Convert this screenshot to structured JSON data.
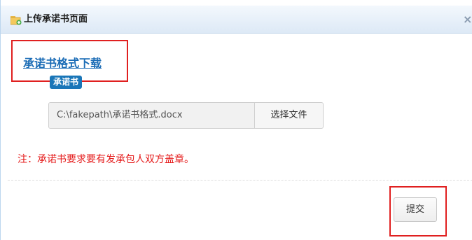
{
  "dialog": {
    "title": "上传承诺书页面",
    "close_label": "×"
  },
  "content": {
    "download_link": "承诺书格式下载",
    "badge": "承诺书",
    "file_input": {
      "value": "C:\\fakepath\\承诺书格式.docx",
      "button_label": "选择文件"
    },
    "note": "注：承诺书要求要有发承包人双方盖章。"
  },
  "footer": {
    "submit_label": "提交"
  },
  "colors": {
    "highlight": "#e02020",
    "link": "#1b6cb6",
    "badge_bg": "#1a76b8",
    "note_text": "#e51c1c"
  },
  "icons": {
    "title_icon": "upload-folder-icon",
    "close_icon": "close-icon"
  }
}
